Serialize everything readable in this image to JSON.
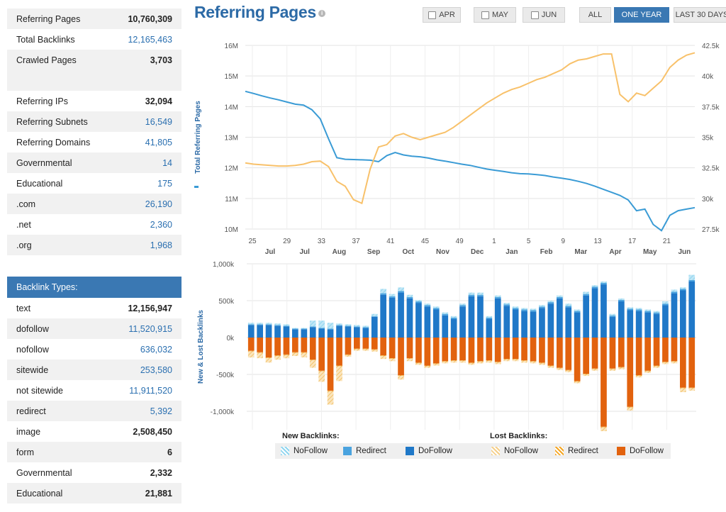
{
  "summary": [
    {
      "label": "Referring Pages",
      "value": "10,760,309",
      "link": false
    },
    {
      "label": "Total Backlinks",
      "value": "12,165,463",
      "link": true
    },
    {
      "label": "Crawled Pages",
      "value": "3,703",
      "link": false
    }
  ],
  "ip_stats": [
    {
      "label": "Referring IPs",
      "value": "32,094",
      "link": false
    },
    {
      "label": "Referring Subnets",
      "value": "16,549",
      "link": true
    },
    {
      "label": "Referring Domains",
      "value": "41,805",
      "link": true
    },
    {
      "label": "Governmental",
      "value": "14",
      "link": true
    },
    {
      "label": "Educational",
      "value": "175",
      "link": true
    },
    {
      "label": ".com",
      "value": "26,190",
      "link": true
    },
    {
      "label": ".net",
      "value": "2,360",
      "link": true
    },
    {
      "label": ".org",
      "value": "1,968",
      "link": true
    }
  ],
  "backlink_types": {
    "header": "Backlink Types:",
    "rows": [
      {
        "label": "text",
        "value": "12,156,947",
        "link": false
      },
      {
        "label": "dofollow",
        "value": "11,520,915",
        "link": true
      },
      {
        "label": "nofollow",
        "value": "636,032",
        "link": true
      },
      {
        "label": "sitewide",
        "value": "253,580",
        "link": true
      },
      {
        "label": "not sitewide",
        "value": "11,911,520",
        "link": true
      },
      {
        "label": "redirect",
        "value": "5,392",
        "link": true
      },
      {
        "label": "image",
        "value": "2,508,450",
        "link": false
      },
      {
        "label": "form",
        "value": "6",
        "link": false
      },
      {
        "label": "Governmental",
        "value": "2,332",
        "link": false
      },
      {
        "label": "Educational",
        "value": "21,881",
        "link": false
      }
    ]
  },
  "page_title": "Referring Pages",
  "info_icon": "i",
  "range_buttons": [
    {
      "label": "APR",
      "checkbox": true,
      "active": false
    },
    {
      "label": "MAY",
      "checkbox": true,
      "active": false
    },
    {
      "label": "JUN",
      "checkbox": true,
      "active": false
    },
    {
      "label": "ALL",
      "checkbox": false,
      "active": false
    },
    {
      "label": "ONE YEAR",
      "checkbox": false,
      "active": true
    },
    {
      "label": "LAST 30 DAYS",
      "checkbox": false,
      "active": false
    }
  ],
  "legend": {
    "new_title": "New Backlinks:",
    "lost_title": "Lost Backlinks:",
    "new_items": [
      {
        "label": "NoFollow",
        "color": "#8fd5ef",
        "hatched": true
      },
      {
        "label": "Redirect",
        "color": "#4aa3df",
        "hatched": false
      },
      {
        "label": "DoFollow",
        "color": "#1f78c8",
        "hatched": false
      }
    ],
    "lost_items": [
      {
        "label": "NoFollow",
        "color": "#f5cf8a",
        "hatched": true
      },
      {
        "label": "Redirect",
        "color": "#f5a623",
        "hatched": true
      },
      {
        "label": "DoFollow",
        "color": "#e2620e",
        "hatched": false
      }
    ]
  },
  "colors": {
    "blue_line": "#3a9bd5",
    "orange_line": "#f8c16a",
    "accent": "#3a78b3"
  },
  "chart_data": [
    {
      "type": "line",
      "ylabel": "Total Referring Pages",
      "ylim": [
        10000000,
        16000000
      ],
      "y_ticks": [
        "10M",
        "11M",
        "12M",
        "13M",
        "14M",
        "15M",
        "16M"
      ],
      "y2lim": [
        27500,
        42500
      ],
      "y2_ticks": [
        "27.5k",
        "30k",
        "32.5k",
        "35k",
        "37.5k",
        "40k",
        "42.5k"
      ],
      "x_week_ticks": [
        "25",
        "29",
        "33",
        "37",
        "41",
        "45",
        "49",
        "1",
        "5",
        "9",
        "13",
        "17",
        "21"
      ],
      "x_month_ticks": [
        "Jul",
        "Jul",
        "Aug",
        "Sep",
        "Oct",
        "Nov",
        "Dec",
        "Jan",
        "Feb",
        "Mar",
        "Apr",
        "May",
        "Jun"
      ],
      "grid": true,
      "series": [
        {
          "name": "Total Referring Pages",
          "axis": "left",
          "color": "#3a9bd5",
          "x": [
            23,
            24,
            25,
            26,
            27,
            28,
            29,
            30,
            31,
            32,
            33,
            34,
            35,
            36,
            37,
            38,
            39,
            40,
            41,
            42,
            43,
            44,
            45,
            46,
            47,
            48,
            49,
            50,
            51,
            52,
            53,
            54,
            55,
            56,
            57,
            58,
            59,
            60,
            61,
            62,
            63,
            64,
            65,
            66,
            67,
            68,
            69,
            70,
            71,
            72,
            73,
            74,
            75,
            76,
            77
          ],
          "values": [
            14500000,
            14430000,
            14350000,
            14280000,
            14220000,
            14150000,
            14080000,
            14050000,
            13900000,
            13600000,
            12950000,
            12330000,
            12280000,
            12270000,
            12260000,
            12250000,
            12200000,
            12400000,
            12500000,
            12420000,
            12380000,
            12360000,
            12320000,
            12260000,
            12220000,
            12170000,
            12120000,
            12080000,
            12020000,
            11960000,
            11920000,
            11880000,
            11840000,
            11810000,
            11800000,
            11780000,
            11750000,
            11700000,
            11660000,
            11620000,
            11560000,
            11490000,
            11400000,
            11300000,
            11200000,
            11100000,
            10950000,
            10600000,
            10650000,
            10150000,
            9950000,
            10450000,
            10600000,
            10650000,
            10700000
          ]
        },
        {
          "name": "Referring Domains",
          "axis": "right",
          "color": "#f8c16a",
          "x": [
            23,
            24,
            25,
            26,
            27,
            28,
            29,
            30,
            31,
            32,
            33,
            34,
            35,
            36,
            37,
            38,
            39,
            40,
            41,
            42,
            43,
            44,
            45,
            46,
            47,
            48,
            49,
            50,
            51,
            52,
            53,
            54,
            55,
            56,
            57,
            58,
            59,
            60,
            61,
            62,
            63,
            64,
            65,
            66,
            67,
            68,
            69,
            70,
            71,
            72,
            73,
            74,
            75,
            76,
            77
          ],
          "values": [
            32900,
            32800,
            32750,
            32700,
            32650,
            32650,
            32700,
            32800,
            33000,
            33050,
            32600,
            31400,
            31000,
            29900,
            29600,
            32400,
            34200,
            34400,
            35100,
            35300,
            35000,
            34800,
            35000,
            35200,
            35400,
            35800,
            36300,
            36800,
            37300,
            37800,
            38200,
            38600,
            38900,
            39100,
            39400,
            39700,
            39900,
            40200,
            40500,
            41000,
            41300,
            41400,
            41600,
            41800,
            41800,
            38500,
            37900,
            38600,
            38400,
            39000,
            39600,
            40700,
            41300,
            41700,
            41900
          ]
        }
      ]
    },
    {
      "type": "bar",
      "ylabel": "New & Lost Backlinks",
      "ylim": [
        -1250000,
        1000000
      ],
      "y_ticks": [
        "-1,000k",
        "-500k",
        "0k",
        "500k",
        "1,000k"
      ],
      "grid": true,
      "series": [
        {
          "name": "DoFollow",
          "group": "New Backlinks",
          "color": "#1f78c8",
          "values": [
            170000,
            170000,
            170000,
            160000,
            150000,
            110000,
            110000,
            140000,
            120000,
            110000,
            160000,
            150000,
            140000,
            130000,
            280000,
            580000,
            540000,
            610000,
            530000,
            470000,
            420000,
            380000,
            300000,
            250000,
            420000,
            560000,
            560000,
            250000,
            530000,
            430000,
            380000,
            360000,
            350000,
            400000,
            460000,
            530000,
            410000,
            340000,
            570000,
            670000,
            720000,
            280000,
            490000,
            370000,
            360000,
            340000,
            320000,
            440000,
            600000,
            640000,
            760000
          ]
        },
        {
          "name": "Redirect",
          "group": "New Backlinks",
          "color": "#4aa3df",
          "values": [
            10000,
            10000,
            10000,
            10000,
            10000,
            10000,
            10000,
            10000,
            10000,
            10000,
            10000,
            10000,
            10000,
            10000,
            10000,
            20000,
            20000,
            20000,
            20000,
            20000,
            20000,
            20000,
            20000,
            20000,
            20000,
            20000,
            20000,
            20000,
            20000,
            20000,
            20000,
            20000,
            20000,
            20000,
            20000,
            20000,
            20000,
            20000,
            20000,
            20000,
            20000,
            20000,
            20000,
            20000,
            20000,
            20000,
            20000,
            20000,
            20000,
            20000,
            20000
          ]
        },
        {
          "name": "NoFollow",
          "group": "New Backlinks",
          "color": "#8fd5ef",
          "values": [
            20000,
            20000,
            20000,
            20000,
            20000,
            10000,
            10000,
            80000,
            100000,
            80000,
            20000,
            20000,
            20000,
            20000,
            30000,
            60000,
            30000,
            50000,
            30000,
            20000,
            20000,
            20000,
            20000,
            20000,
            20000,
            30000,
            30000,
            20000,
            20000,
            20000,
            20000,
            20000,
            20000,
            20000,
            20000,
            20000,
            30000,
            20000,
            30000,
            20000,
            20000,
            20000,
            20000,
            20000,
            20000,
            20000,
            20000,
            30000,
            30000,
            20000,
            70000
          ]
        },
        {
          "name": "DoFollow",
          "group": "Lost Backlinks",
          "color": "#e2620e",
          "values": [
            -180000,
            -200000,
            -270000,
            -240000,
            -230000,
            -200000,
            -200000,
            -300000,
            -450000,
            -720000,
            -380000,
            -230000,
            -150000,
            -150000,
            -160000,
            -240000,
            -280000,
            -510000,
            -280000,
            -340000,
            -380000,
            -350000,
            -320000,
            -310000,
            -310000,
            -340000,
            -320000,
            -310000,
            -330000,
            -290000,
            -290000,
            -310000,
            -320000,
            -340000,
            -380000,
            -410000,
            -440000,
            -590000,
            -490000,
            -420000,
            -1210000,
            -420000,
            -400000,
            -940000,
            -510000,
            -450000,
            -380000,
            -330000,
            -320000,
            -680000,
            -680000
          ]
        },
        {
          "name": "Redirect",
          "group": "Lost Backlinks",
          "color": "#f5a623",
          "values": [
            -10000,
            -10000,
            -10000,
            -10000,
            -10000,
            -10000,
            -10000,
            -10000,
            -10000,
            -10000,
            -10000,
            -10000,
            -10000,
            -10000,
            -10000,
            -10000,
            -10000,
            -10000,
            -10000,
            -10000,
            -10000,
            -10000,
            -10000,
            -10000,
            -10000,
            -10000,
            -10000,
            -10000,
            -10000,
            -10000,
            -10000,
            -10000,
            -10000,
            -10000,
            -10000,
            -10000,
            -10000,
            -10000,
            -10000,
            -10000,
            -10000,
            -10000,
            -10000,
            -10000,
            -10000,
            -10000,
            -10000,
            -10000,
            -10000,
            -10000,
            -10000
          ]
        },
        {
          "name": "NoFollow",
          "group": "Lost Backlinks",
          "color": "#f5cf8a",
          "values": [
            -80000,
            -70000,
            -60000,
            -50000,
            -40000,
            -40000,
            -60000,
            -100000,
            -140000,
            -180000,
            -200000,
            -20000,
            -20000,
            -20000,
            -20000,
            -40000,
            -30000,
            -50000,
            -30000,
            -20000,
            -20000,
            -20000,
            -20000,
            -20000,
            -20000,
            -20000,
            -20000,
            -20000,
            -20000,
            -20000,
            -20000,
            -20000,
            -20000,
            -20000,
            -20000,
            -20000,
            -20000,
            -20000,
            -20000,
            -20000,
            -50000,
            -20000,
            -20000,
            -40000,
            -20000,
            -20000,
            -20000,
            -20000,
            -20000,
            -50000,
            -30000
          ]
        }
      ]
    }
  ]
}
